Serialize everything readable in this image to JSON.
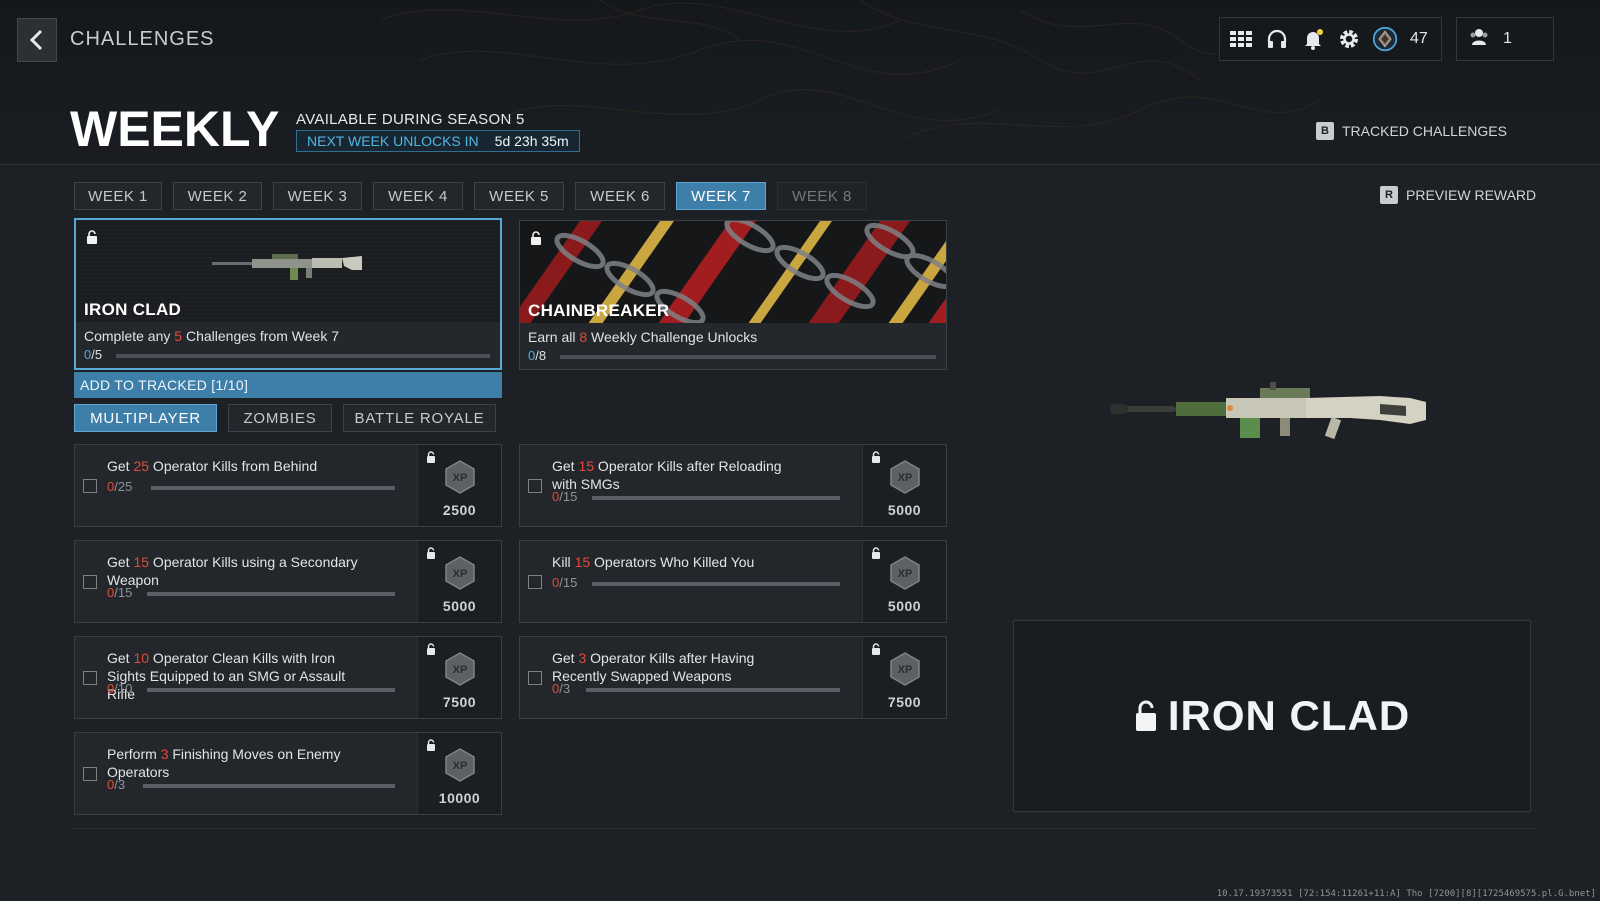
{
  "header": {
    "crumb": "CHALLENGES",
    "title": "WEEKLY",
    "season": "AVAILABLE DURING SEASON 5",
    "unlock_label": "NEXT WEEK UNLOCKS IN",
    "unlock_time": "5d 23h 35m",
    "level": "47",
    "party_count": "1",
    "tracked_key": "B",
    "tracked_label": "TRACKED CHALLENGES",
    "preview_key": "R",
    "preview_label": "PREVIEW REWARD"
  },
  "weeks": [
    {
      "label": "WEEK 1",
      "state": "normal"
    },
    {
      "label": "WEEK 2",
      "state": "normal"
    },
    {
      "label": "WEEK 3",
      "state": "normal"
    },
    {
      "label": "WEEK 4",
      "state": "normal"
    },
    {
      "label": "WEEK 5",
      "state": "normal"
    },
    {
      "label": "WEEK 6",
      "state": "normal"
    },
    {
      "label": "WEEK 7",
      "state": "active"
    },
    {
      "label": "WEEK 8",
      "state": "locked"
    }
  ],
  "rewards": {
    "ironclad": {
      "name": "IRON CLAD",
      "desc_a": "Complete any ",
      "desc_n": "5",
      "desc_b": " Challenges from Week 7",
      "progress_cur": "0",
      "progress_total": "/5",
      "progress_frac": 0
    },
    "chainbreaker": {
      "name": "CHAINBREAKER",
      "desc_a": "Earn all ",
      "desc_n": "8",
      "desc_b": " Weekly Challenge Unlocks",
      "progress_cur": "0",
      "progress_total": "/8",
      "progress_frac": 0
    },
    "add_tracked": "ADD TO TRACKED [1/10]"
  },
  "modes": [
    {
      "label": "MULTIPLAYER",
      "active": true
    },
    {
      "label": "ZOMBIES",
      "active": false
    },
    {
      "label": "BATTLE ROYALE",
      "active": false
    }
  ],
  "challenges": [
    {
      "a": "Get ",
      "n": "25",
      "b": " Operator Kills from Behind",
      "cur": "0",
      "total": "/25",
      "xp": "2500",
      "frac": 0
    },
    {
      "a": "Get ",
      "n": "15",
      "b": " Operator Kills after Reloading with SMGs",
      "cur": "0",
      "total": "/15",
      "xp": "5000",
      "frac": 0
    },
    {
      "a": "Get ",
      "n": "15",
      "b": " Operator Kills using a Secondary Weapon",
      "cur": "0",
      "total": "/15",
      "xp": "5000",
      "frac": 0
    },
    {
      "a": "Kill ",
      "n": "15",
      "b": " Operators Who Killed You",
      "cur": "0",
      "total": "/15",
      "xp": "5000",
      "frac": 0
    },
    {
      "a": "Get ",
      "n": "10",
      "b": " Operator Clean Kills with Iron Sights Equipped to an SMG or Assault Rifle",
      "cur": "0",
      "total": "/10",
      "xp": "7500",
      "frac": 0
    },
    {
      "a": "Get ",
      "n": "3",
      "b": " Operator Kills after Having Recently Swapped Weapons",
      "cur": "0",
      "total": "/3",
      "xp": "7500",
      "frac": 0
    },
    {
      "a": "Perform ",
      "n": "3",
      "b": " Finishing Moves on Enemy Operators",
      "cur": "0",
      "total": "/3",
      "xp": "10000",
      "frac": 0
    }
  ],
  "preview": {
    "name": "IRON CLAD"
  },
  "build_string": "10.17.19373551 [72:154:11261+11:A] Tho [7200][8][1725469575.pl.G.bnet]",
  "colors": {
    "accent": "#3d7fa8",
    "highlight": "#e24a3b",
    "progress_blue": "#4fa9dc"
  }
}
